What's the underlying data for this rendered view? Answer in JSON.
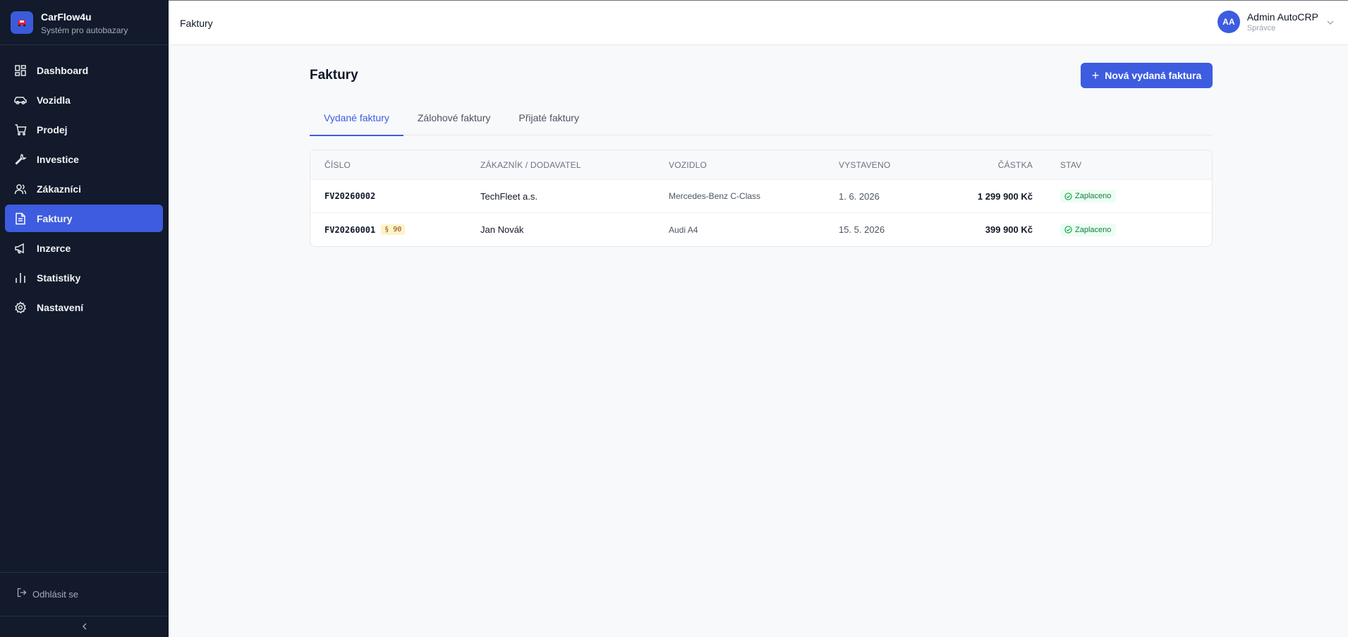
{
  "brand": {
    "name": "CarFlow4u",
    "subtitle": "Systém pro autobazary"
  },
  "sidebar": {
    "items": [
      {
        "label": "Dashboard",
        "icon": "dashboard-icon"
      },
      {
        "label": "Vozidla",
        "icon": "car-icon"
      },
      {
        "label": "Prodej",
        "icon": "cart-icon"
      },
      {
        "label": "Investice",
        "icon": "wrench-icon"
      },
      {
        "label": "Zákazníci",
        "icon": "users-icon"
      },
      {
        "label": "Faktury",
        "icon": "document-icon",
        "active": true
      },
      {
        "label": "Inzerce",
        "icon": "megaphone-icon"
      },
      {
        "label": "Statistiky",
        "icon": "bar-chart-icon"
      },
      {
        "label": "Nastavení",
        "icon": "gear-icon"
      }
    ],
    "logout_label": "Odhlásit se"
  },
  "topbar": {
    "breadcrumb": "Faktury",
    "user": {
      "initials": "AA",
      "name": "Admin AutoCRP",
      "role": "Správce"
    }
  },
  "page": {
    "title": "Faktury",
    "new_button_label": "Nová vydaná faktura",
    "tabs": [
      {
        "label": "Vydané faktury",
        "active": true
      },
      {
        "label": "Zálohové faktury"
      },
      {
        "label": "Přijaté faktury"
      }
    ]
  },
  "table": {
    "headers": {
      "number": "ČÍSLO",
      "customer": "ZÁKAZNÍK / DODAVATEL",
      "vehicle": "VOZIDLO",
      "issued": "VYSTAVENO",
      "amount": "ČÁSTKA",
      "status": "STAV"
    },
    "rows": [
      {
        "number": "FV20260002",
        "tag": "",
        "customer": "TechFleet a.s.",
        "vehicle": "Mercedes-Benz C-Class",
        "issued": "1. 6. 2026",
        "amount": "1 299 900 Kč",
        "status": "Zaplaceno"
      },
      {
        "number": "FV20260001",
        "tag": "§ 90",
        "customer": "Jan Novák",
        "vehicle": "Audi A4",
        "issued": "15. 5. 2026",
        "amount": "399 900 Kč",
        "status": "Zaplaceno"
      }
    ]
  },
  "colors": {
    "accent": "#3d5ce0",
    "sidebar_bg": "#121a2b",
    "status_paid": "#15803d",
    "tag_bg": "#fdf3c7"
  }
}
